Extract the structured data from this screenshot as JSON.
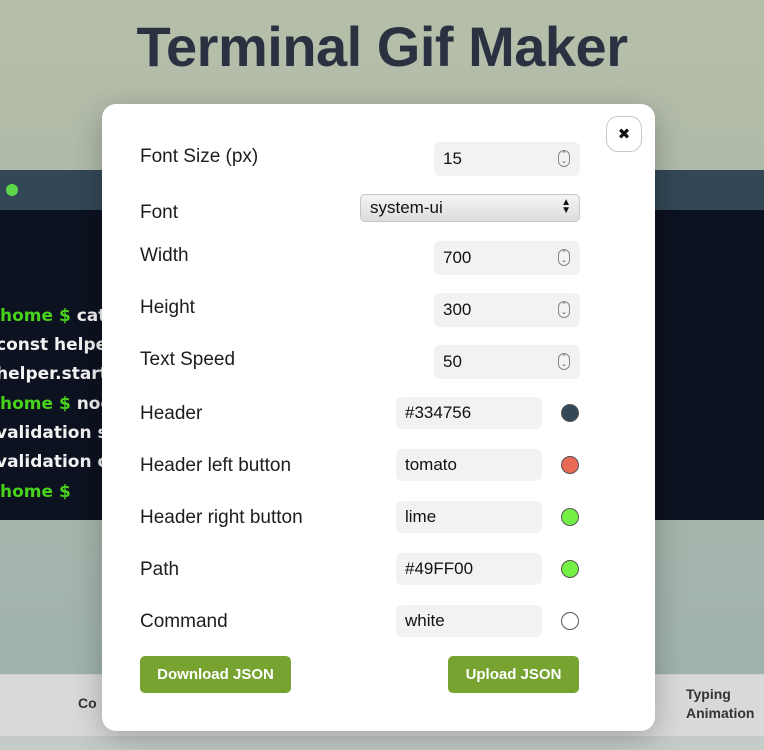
{
  "page": {
    "title": "Terminal Gif Maker"
  },
  "terminal": {
    "lines": [
      {
        "path": "home $",
        "text": " cat i"
      },
      {
        "path": "",
        "text": "const helper"
      },
      {
        "path": "",
        "text": "helper.startV"
      },
      {
        "path": "home $",
        "text": " node"
      },
      {
        "path": "",
        "text": "validation sta"
      },
      {
        "path": "",
        "text": "validation co"
      },
      {
        "path": "home $",
        "text": ""
      }
    ]
  },
  "table": {
    "col_left_header": "Co",
    "col_right_header_line1": "Typing",
    "col_right_header_line2": "Animation"
  },
  "modal": {
    "close_icon": "✖",
    "fields": {
      "font_size": {
        "label": "Font Size (px)",
        "value": "15"
      },
      "font": {
        "label": "Font",
        "value": "system-ui"
      },
      "width": {
        "label": "Width",
        "value": "700"
      },
      "height": {
        "label": "Height",
        "value": "300"
      },
      "text_speed": {
        "label": "Text Speed",
        "value": "50"
      },
      "header": {
        "label": "Header",
        "value": "#334756",
        "swatch": "#334756"
      },
      "header_left_button": {
        "label": "Header left button",
        "value": "tomato",
        "swatch": "#e96a55"
      },
      "header_right_button": {
        "label": "Header right button",
        "value": "lime",
        "swatch": "#74ef46"
      },
      "path": {
        "label": "Path",
        "value": "#49FF00",
        "swatch": "#74ef46"
      },
      "command": {
        "label": "Command",
        "value": "white",
        "swatch": "#ffffff"
      }
    },
    "buttons": {
      "download": "Download JSON",
      "upload": "Upload JSON"
    }
  },
  "colors": {
    "accent_button": "#77a331",
    "title_text": "#2a3241",
    "terminal_bg": "#0d1220",
    "terminal_header": "#334756"
  }
}
